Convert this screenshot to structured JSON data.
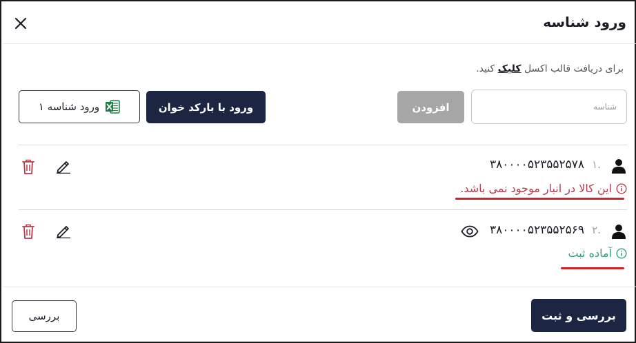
{
  "dialog": {
    "title": "ورود شناسه",
    "close_icon": "close-icon"
  },
  "hint": {
    "before": "برای دریافت قالب اکسل",
    "link": "کلیک",
    "after": "کنید."
  },
  "form": {
    "input_placeholder": "شناسه",
    "input_value": "",
    "add_label": "افزودن",
    "barcode_label": "ورود با بارکد خوان",
    "excel_label": "ورود شناسه ۱"
  },
  "items": [
    {
      "index": "۱.",
      "code": "۳۸۰۰۰۰۵۲۳۵۵۲۵۷۸",
      "status": "این کالا در انبار موجود نمی باشد.",
      "status_type": "error",
      "has_view": false
    },
    {
      "index": "۲.",
      "code": "۳۸۰۰۰۰۵۲۳۵۵۲۵۶۹",
      "status": "آماده ثبت",
      "status_type": "ok",
      "has_view": true
    }
  ],
  "footer": {
    "submit_label": "بررسی و ثبت",
    "review_label": "بررسی"
  },
  "colors": {
    "primary": "#1c2541",
    "disabled": "#a6a6a6",
    "error": "#b83a4b",
    "success": "#2e9e79",
    "underline": "#d0202a"
  }
}
